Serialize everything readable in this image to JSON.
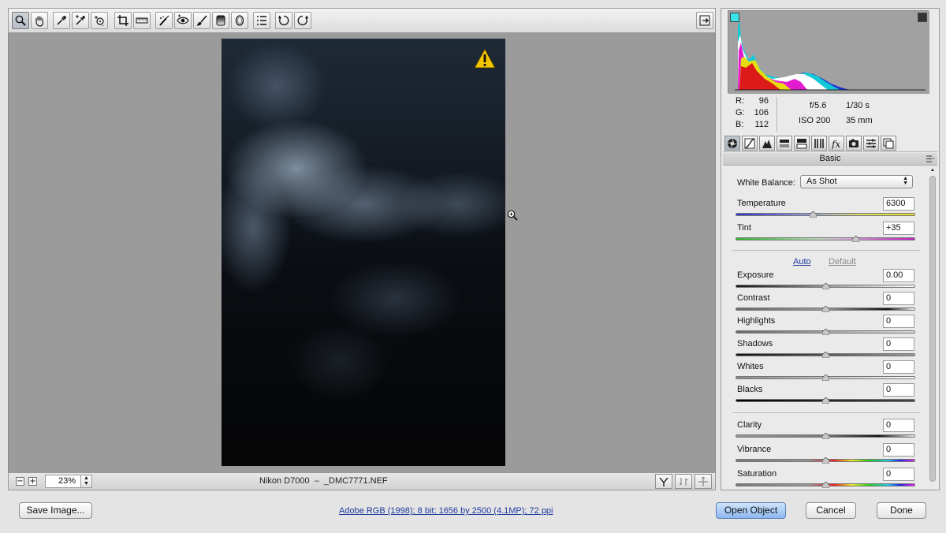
{
  "toolbar": {
    "tools": [
      {
        "name": "zoom-tool",
        "icon": "magnifier-icon",
        "active": true
      },
      {
        "name": "hand-tool",
        "icon": "hand-icon"
      },
      {
        "name": "white-balance-tool",
        "icon": "eyedropper-icon"
      },
      {
        "name": "color-sampler-tool",
        "icon": "color-sampler-icon"
      },
      {
        "name": "targeted-adjustment-tool",
        "icon": "target-adjust-icon"
      },
      {
        "name": "crop-tool",
        "icon": "crop-icon"
      },
      {
        "name": "straighten-tool",
        "icon": "straighten-icon"
      },
      {
        "name": "spot-removal-tool",
        "icon": "spot-removal-icon"
      },
      {
        "name": "red-eye-tool",
        "icon": "eye-icon"
      },
      {
        "name": "adjustment-brush-tool",
        "icon": "brush-icon"
      },
      {
        "name": "graduated-filter-tool",
        "icon": "graduated-filter-icon"
      },
      {
        "name": "radial-filter-tool",
        "icon": "radial-filter-icon"
      },
      {
        "name": "preferences-tool",
        "icon": "list-icon"
      },
      {
        "name": "rotate-left-tool",
        "icon": "rotate-ccw-icon"
      },
      {
        "name": "rotate-right-tool",
        "icon": "rotate-cw-icon"
      }
    ],
    "exit_icon": "toggle-fullscreen-icon"
  },
  "status_bar": {
    "zoom_value": "23%",
    "camera_file": "Nikon D7000  –  _DMC7771.NEF"
  },
  "info": {
    "r_label": "R:",
    "r": "96",
    "g_label": "G:",
    "g": "106",
    "b_label": "B:",
    "b": "112",
    "aperture": "f/5.6",
    "shutter": "1/30 s",
    "iso": "ISO 200",
    "focal": "35 mm"
  },
  "panel": {
    "section_title": "Basic",
    "white_balance_label": "White Balance:",
    "white_balance_value": "As Shot",
    "auto_label": "Auto",
    "default_label": "Default",
    "sliders": {
      "temperature": {
        "label": "Temperature",
        "value": "6300",
        "level": 0.43
      },
      "tint": {
        "label": "Tint",
        "value": "+35",
        "level": 0.67
      },
      "exposure": {
        "label": "Exposure",
        "value": "0.00",
        "level": 0.5
      },
      "contrast": {
        "label": "Contrast",
        "value": "0",
        "level": 0.5
      },
      "highlights": {
        "label": "Highlights",
        "value": "0",
        "level": 0.5
      },
      "shadows": {
        "label": "Shadows",
        "value": "0",
        "level": 0.5
      },
      "whites": {
        "label": "Whites",
        "value": "0",
        "level": 0.5
      },
      "blacks": {
        "label": "Blacks",
        "value": "0",
        "level": 0.5
      },
      "clarity": {
        "label": "Clarity",
        "value": "0",
        "level": 0.5
      },
      "vibrance": {
        "label": "Vibrance",
        "value": "0",
        "level": 0.5
      },
      "saturation": {
        "label": "Saturation",
        "value": "0",
        "level": 0.5
      }
    }
  },
  "bottom": {
    "save_label": "Save Image...",
    "workflow_link": "Adobe RGB (1998); 8 bit; 1656 by 2500 (4.1MP); 72 ppi",
    "open_label": "Open Object",
    "cancel_label": "Cancel",
    "done_label": "Done"
  },
  "colors": {
    "accent_blue": "#8cb8ef",
    "link_blue": "#1d3a9e",
    "warning_yellow": "#f2c500"
  }
}
